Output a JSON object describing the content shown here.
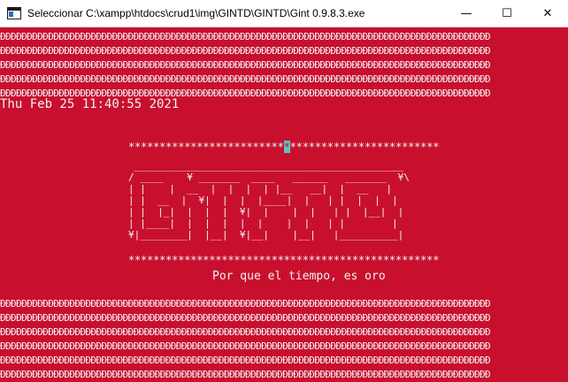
{
  "window": {
    "title": "Seleccionar C:\\xampp\\htdocs\\crud1\\img\\GINTD\\GINTD\\Gint 0.9.8.3.exe",
    "icon": "console-window-icon",
    "controls": {
      "minimize": "—",
      "maximize": "☐",
      "close": "✕"
    }
  },
  "console": {
    "background_color": "#c8102e",
    "text_color": "#f2f2f2",
    "fill_char_row": "ÐÐÐÐÐÐÐÐÐÐÐÐÐÐÐÐÐÐÐÐÐÐÐÐÐÐÐÐÐÐÐÐÐÐÐÐÐÐÐÐÐÐÐÐÐÐÐÐÐÐÐÐÐÐÐÐÐÐÐÐÐÐÐÐÐÐÐÐÐÐÐÐÐÐÐÐÐÐÐÐÐÐÐÐÐÐÐÐÐÐÐÐ",
    "timestamp": "Thu Feb 25 11:40:55 2021",
    "stars_left": "*************************",
    "stars_cursor": "*",
    "stars_right": "************************",
    "stars_bottom": "**************************************************",
    "logo_art": " ______________________________________________\n/ ____    ¥ _______  ____   ______   _______  ¥\\\n| |    |  __  |  |  |  | |__   __|  |  __   |\n| |  __  |  ¥|  |  |  |____|  |   | |  |  |  |\n| |  |_|  |  |  |  ¥|  |    |  |   | |  |__|  |\n| |____|  |  |  |  |  |    |  |   | |        |\n¥|________|  |__|  ¥|__|    |__|   |__________|",
    "tagline": "Por que el tiempo, es oro"
  }
}
